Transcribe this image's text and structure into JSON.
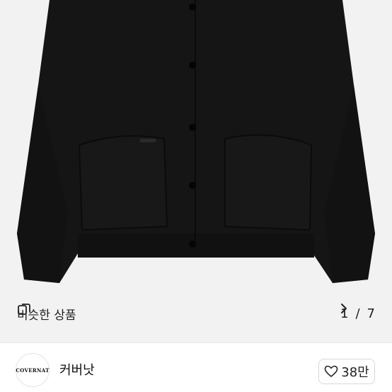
{
  "product": {
    "image_alt": "black jacket product photo",
    "pager": {
      "current": "1",
      "separator": "/",
      "total": "7"
    },
    "similar_button_label": "비슷한 상품"
  },
  "seller": {
    "avatar_text": "COVERNAT",
    "name": "커버낫",
    "likes": "38만"
  },
  "icons": {
    "similar": "similar-products-icon",
    "next": "chevron-right-icon",
    "like": "heart-outline-icon"
  },
  "colors": {
    "background": "#f2f2f2",
    "jacket": "#141414"
  }
}
